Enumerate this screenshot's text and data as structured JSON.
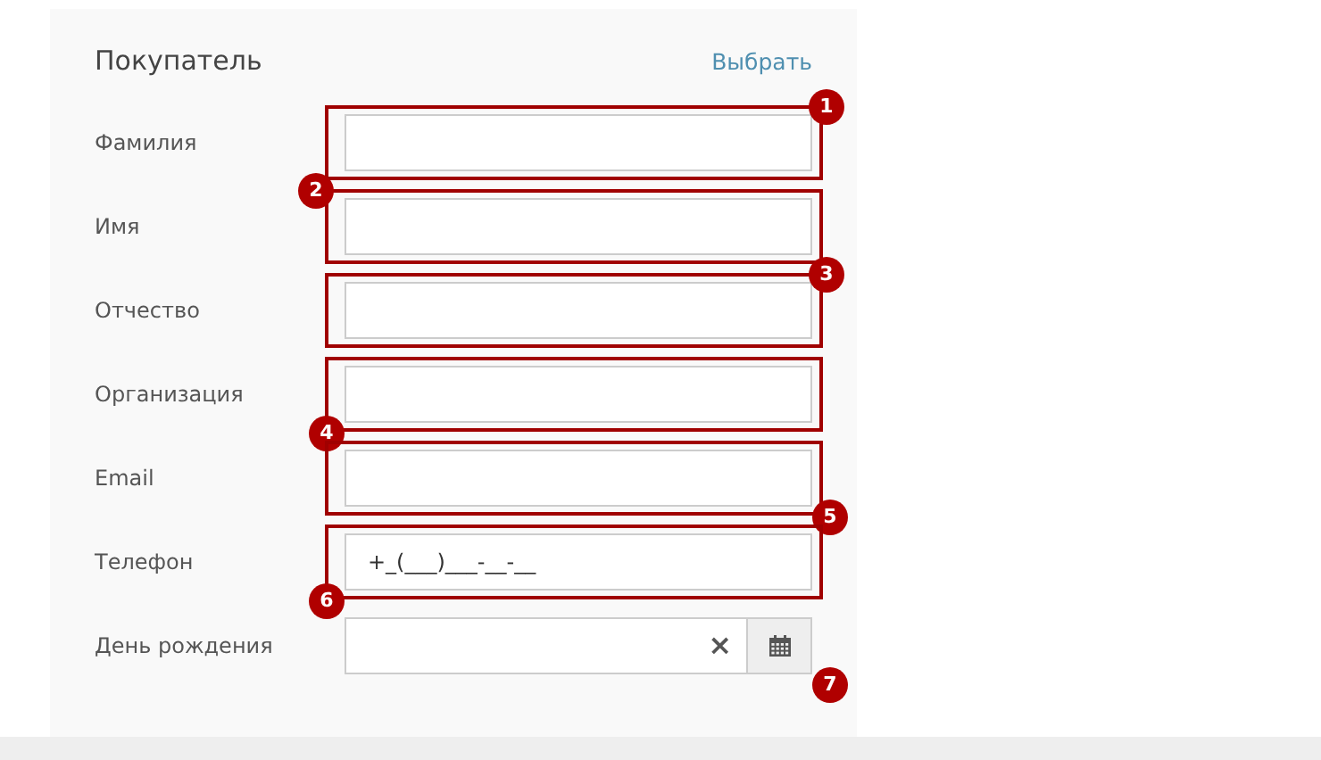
{
  "section": {
    "title": "Покупатель",
    "action": "Выбрать"
  },
  "fields": [
    {
      "kind": "text",
      "label": "Фамилия",
      "outlined": true,
      "callout": "1"
    },
    {
      "kind": "text",
      "label": "Имя",
      "outlined": true,
      "callout": "2"
    },
    {
      "kind": "text",
      "label": "Отчество",
      "outlined": true,
      "callout": "3"
    },
    {
      "kind": "text",
      "label": "Организация",
      "outlined": true,
      "callout": "4"
    },
    {
      "kind": "text",
      "label": "Email",
      "outlined": true,
      "callout": "5"
    },
    {
      "kind": "text",
      "label": "Телефон",
      "value": "+_(___)___-__-__",
      "outlined": true,
      "callout": "6"
    },
    {
      "kind": "date",
      "label": "День рождения",
      "clear": "×",
      "outlined": false,
      "callout": "7"
    }
  ]
}
